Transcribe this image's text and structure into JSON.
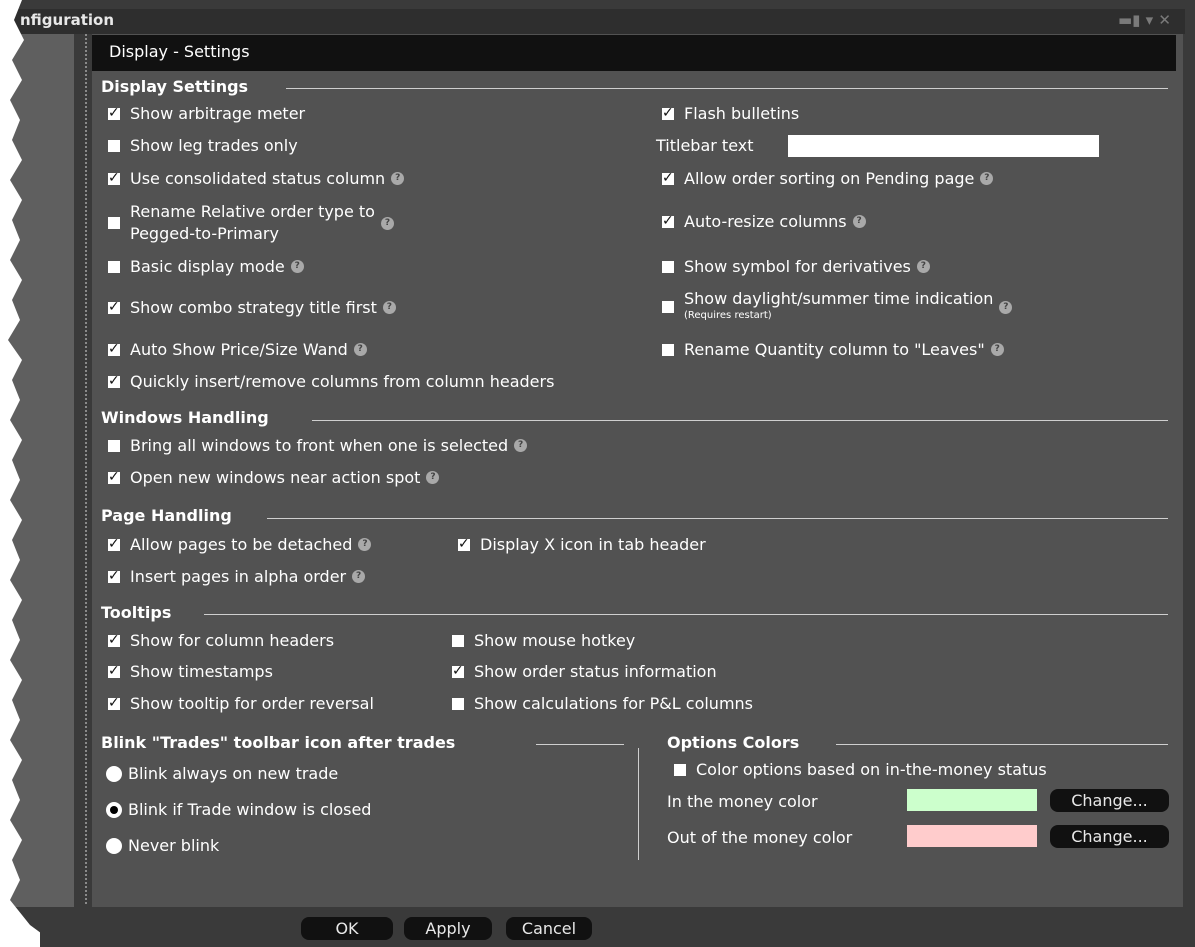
{
  "window": {
    "title": "nfiguration"
  },
  "header": {
    "title": "Display - Settings"
  },
  "display_settings": {
    "heading": "Display Settings",
    "left": [
      {
        "label": "Show arbitrage meter",
        "checked": true,
        "help": false
      },
      {
        "label": "Show leg trades only",
        "checked": false,
        "help": false
      },
      {
        "label": "Use consolidated status column",
        "checked": true,
        "help": true
      },
      {
        "label": "Rename Relative order type to",
        "label2": "Pegged-to-Primary",
        "checked": false,
        "help": true
      },
      {
        "label": "Basic display mode",
        "checked": false,
        "help": true
      },
      {
        "label": "Show combo strategy title first",
        "checked": true,
        "help": true
      },
      {
        "label": "Auto Show Price/Size Wand",
        "checked": true,
        "help": true
      },
      {
        "label": "Quickly insert/remove columns from column headers",
        "checked": true,
        "help": false
      }
    ],
    "right": [
      {
        "label": "Flash bulletins",
        "checked": true,
        "help": false
      },
      {
        "label": "Allow order sorting on Pending page",
        "checked": true,
        "help": true
      },
      {
        "label": "Auto-resize columns",
        "checked": true,
        "help": true
      },
      {
        "label": "Show symbol for derivatives",
        "checked": false,
        "help": true
      },
      {
        "label": "Show daylight/summer time indication",
        "note": "(Requires restart)",
        "checked": false,
        "help": true
      },
      {
        "label": "Rename Quantity column to \"Leaves\"",
        "checked": false,
        "help": true
      }
    ],
    "titlebar_text_label": "Titlebar text",
    "titlebar_text_value": ""
  },
  "windows_handling": {
    "heading": "Windows Handling",
    "items": [
      {
        "label": "Bring all windows to  front when one is selected",
        "checked": false,
        "help": true
      },
      {
        "label": "Open new windows near action spot",
        "checked": true,
        "help": true
      }
    ]
  },
  "page_handling": {
    "heading": "Page Handling",
    "items": [
      {
        "label": "Allow pages to be detached",
        "checked": true,
        "help": true
      },
      {
        "label": "Display X icon in tab header",
        "checked": true,
        "help": false
      },
      {
        "label": "Insert pages in alpha order",
        "checked": true,
        "help": true
      }
    ]
  },
  "tooltips": {
    "heading": "Tooltips",
    "items": [
      {
        "label": "Show for column headers",
        "checked": true
      },
      {
        "label": "Show mouse hotkey",
        "checked": false
      },
      {
        "label": "Show timestamps",
        "checked": true
      },
      {
        "label": "Show order status information",
        "checked": true
      },
      {
        "label": "Show tooltip for order reversal",
        "checked": true
      },
      {
        "label": "Show calculations for P&L columns",
        "checked": false
      }
    ]
  },
  "blink": {
    "heading": "Blink \"Trades\" toolbar icon after trades",
    "options": [
      {
        "label": "Blink always on new trade",
        "selected": false
      },
      {
        "label": "Blink if Trade window is closed",
        "selected": true
      },
      {
        "label": "Never blink",
        "selected": false
      }
    ]
  },
  "options_colors": {
    "heading": "Options Colors",
    "color_options": {
      "label": "Color options based on in-the-money status",
      "checked": false
    },
    "itm_label": "In the money color",
    "itm_color": "#ccffcc",
    "otm_label": "Out of the money color",
    "otm_color": "#ffcccc",
    "change_label": "Change..."
  },
  "buttons": {
    "ok": "OK",
    "apply": "Apply",
    "cancel": "Cancel"
  },
  "colors": {
    "panel": "#525252",
    "header": "#111111",
    "sidebar": "#5f5f5f"
  },
  "icons": {
    "help": "help-icon",
    "pin": "pin-icon",
    "menu": "menu-icon",
    "close": "close-icon"
  }
}
